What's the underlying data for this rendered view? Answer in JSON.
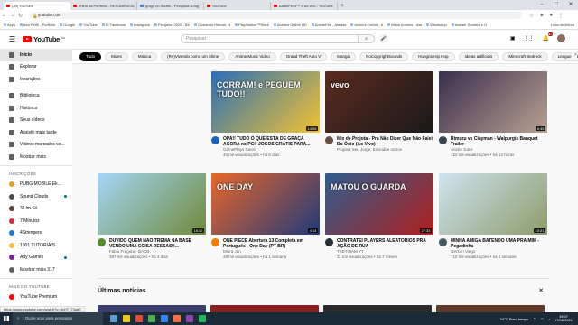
{
  "browser": {
    "tabs": [
      {
        "label": "(28) YouTube",
        "active": true,
        "favicon_color": "#ff0000"
      },
      {
        "label": "Trilha da Periferia - RESUMÊNCIA",
        "favicon_color": "#ff0000"
      },
      {
        "label": "grags no Steam - Pesquisa Goog",
        "favicon_color": "#4285f4"
      },
      {
        "label": "YouTube",
        "favicon_color": "#ff0000"
      },
      {
        "label": "BattleField™ V ao vivo - YouTube",
        "favicon_color": "#ff0000"
      }
    ],
    "new_tab": "+",
    "window_controls": [
      "–",
      "□",
      "✕"
    ],
    "url": "youtube.com",
    "bookmarks": [
      "Apps",
      "Itaú Perfil - Portfólio",
      "Google",
      "YouTube",
      "El Facebook",
      "Instagram",
      "Pesquisa 2020 - Be",
      "Comando Hitman: N",
      "PlayStation™Store",
      "Animes Online HD",
      "AnimeFire - Assista",
      "Animes Online - A",
      "Meus Animes - Ass",
      "WhatsApp",
      "Assistir Sombra e O"
    ],
    "bookmarks_right": "Lista de leitura"
  },
  "header": {
    "logo_text": "YouTube",
    "country": "BR",
    "search_placeholder": "Pesquisar",
    "search_icon": "search-icon",
    "notif_count": "9+"
  },
  "sidebar": {
    "main": [
      {
        "label": "Início",
        "icon": "home-icon",
        "active": true
      },
      {
        "label": "Explorar",
        "icon": "explore-icon"
      },
      {
        "label": "Inscrições",
        "icon": "subscriptions-icon"
      }
    ],
    "library": [
      {
        "label": "Biblioteca",
        "icon": "library-icon"
      },
      {
        "label": "Histórico",
        "icon": "history-icon"
      },
      {
        "label": "Seus vídeos",
        "icon": "your-videos-icon"
      },
      {
        "label": "Assistir mais tarde",
        "icon": "watch-later-icon"
      },
      {
        "label": "Vídeos marcados co...",
        "icon": "liked-icon"
      },
      {
        "label": "Mostrar mais",
        "icon": "chevron-down-icon"
      }
    ],
    "subs_heading": "INSCRIÇÕES",
    "subs": [
      {
        "label": "PUBG MOBILE Ek...",
        "color": "#e0a030"
      },
      {
        "label": "Sound Clouds",
        "color": "#4a4a4a",
        "dot": true
      },
      {
        "label": "3 Um Só",
        "color": "#5d4037"
      },
      {
        "label": "7 Minutoz",
        "color": "#d32f2f"
      },
      {
        "label": "4Strimpers",
        "color": "#1976d2"
      },
      {
        "label": "1001 TUTORIAIS",
        "color": "#fbc02d"
      },
      {
        "label": "Ady Games",
        "color": "#7b1fa2",
        "dot": true
      },
      {
        "label": "Mostrar mais 317",
        "color": "#606060"
      }
    ],
    "more_heading": "MAIS DO YOUTUBE",
    "more": [
      {
        "label": "YouTube Premium",
        "color": "#ff0000"
      }
    ]
  },
  "chips": [
    "Tudo",
    "Mixes",
    "Música",
    "(Re)Vivendo como um Slime",
    "Anime Music Video",
    "Grand Theft Auto V",
    "Mangá",
    "NoCopyrightSounds",
    "Hungria Hip Hop",
    "Ideias artificiais",
    "Minecraft Bedrock",
    "League of Lege"
  ],
  "videos": [
    {
      "title": "OPA!! TUDO O QUE ESTÁ DE GRAÇA AGORA no PC!! JOGOS GRÁTIS PARA...",
      "channel": "GamePlays Cassi",
      "stats": "40 mil visualizações • há 6 dias",
      "duration": "14:06",
      "thumb_a": "#2a6fb8",
      "thumb_b": "#f2c230",
      "avatar": "#1565c0",
      "thumb_text": "CORRAM! e PEGUEM TUDO!!"
    },
    {
      "title": "Mix de Projota - Pra Não Dizer Que Não Falei Do Ódio (Ao Vivo)",
      "channel": "Projota, Seu Jorge, Emicidae outros",
      "stats": "",
      "duration": "",
      "thumb_a": "#5a2b1f",
      "thumb_b": "#1a1a1a",
      "avatar": "#6d4c41",
      "thumb_text": "vevo"
    },
    {
      "title": "Rimuru vs Clayman - Walpurgis Banquet Trailer",
      "channel": "Anime Juice",
      "stats": "122 mil visualizações • há 13 horas",
      "duration": "0:35",
      "thumb_a": "#3b2f4f",
      "thumb_b": "#b8a090",
      "avatar": "#37474f",
      "thumb_text": ""
    },
    {
      "title": "DUVIDO QUEM NÃO TREMA NA BASE VENDO UMA COISA DESSAS!!...",
      "channel": "Fabio Fregota - BACB",
      "stats": "387 mil visualizações • há 4 dias",
      "duration": "15:32",
      "thumb_a": "#a5d6f7",
      "thumb_b": "#6f8a3c",
      "avatar": "#558b2f",
      "thumb_text": ""
    },
    {
      "title": "ONE PIECE Abertura 13 Completa em Português - One Day (PT-BR)",
      "channel": "Miura Jun",
      "stats": "28 mil visualizações • há 1 semana",
      "duration": "4:14",
      "thumb_a": "#e8672a",
      "thumb_b": "#213a7a",
      "avatar": "#f57c00",
      "thumb_text": "ONE DAY"
    },
    {
      "title": "CONTRATEI PLAYERS ALEATÓRIOS PRA AÇÃO DE RUA",
      "channel": "TXETINAM YT",
      "stats": "11 mil visualizações • há 7 meses",
      "duration": "27:33",
      "thumb_a": "#2e5d8c",
      "thumb_b": "#b02020",
      "avatar": "#263238",
      "thumb_text": "MATOU O GUARDA"
    },
    {
      "title": "MINHA AMIGA BATENDO UMA PRA MIM - Pegadinha",
      "channel": "Gerson Viego",
      "stats": "710 mil visualizações • há 1 semana",
      "duration": "10:31",
      "thumb_a": "#cfe3f0",
      "thumb_b": "#8c9c6a",
      "avatar": "#455a64",
      "thumb_text": ""
    }
  ],
  "news": {
    "title": "Últimas notícias",
    "close": "✕",
    "colors": [
      "#3a3f6b",
      "#8a1f1f",
      "#2b2b2b",
      "#5e3a2a"
    ]
  },
  "status_url": "https://www.youtube.com/watch?v=8cHT_73ubE",
  "taskbar": {
    "search_placeholder": "Digite aqui para pesquisar",
    "apps": [
      "#5b9bd5",
      "#f2c811",
      "#e04b3a",
      "#4caf50",
      "#3b82f6",
      "#ff7043",
      "#8e44ad",
      "#1db954"
    ],
    "weather": "24°C Prev. tempo",
    "time": "19:47",
    "date": "17/08/2021"
  }
}
